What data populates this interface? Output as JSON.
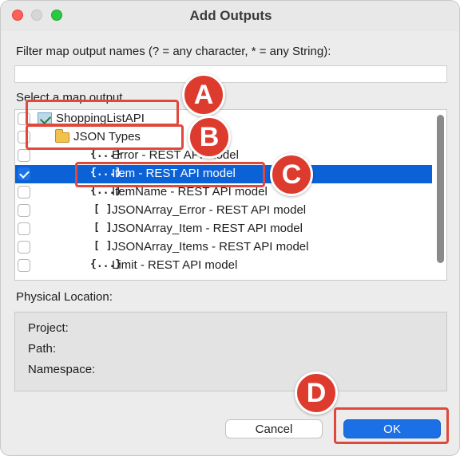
{
  "window": {
    "title": "Add Outputs"
  },
  "filter": {
    "label": "Filter map output names (? = any character, * = any String):",
    "value": ""
  },
  "select": {
    "label": "Select a map output"
  },
  "tree": {
    "rows": [
      {
        "label": "ShoppingListAPI",
        "icon": "api-project-icon",
        "checked": false,
        "selected": false
      },
      {
        "label": "JSON Types",
        "icon": "folder-icon",
        "checked": false,
        "selected": false
      },
      {
        "label": "Error - REST API model",
        "icon": "{...}",
        "checked": false,
        "selected": false
      },
      {
        "label": "Item - REST API model",
        "icon": "{...}",
        "checked": true,
        "selected": true
      },
      {
        "label": "ItemName - REST API model",
        "icon": "{...}",
        "checked": false,
        "selected": false
      },
      {
        "label": "JSONArray_Error - REST API model",
        "icon": "[ ]",
        "checked": false,
        "selected": false
      },
      {
        "label": "JSONArray_Item - REST API model",
        "icon": "[ ]",
        "checked": false,
        "selected": false
      },
      {
        "label": "JSONArray_Items - REST API model",
        "icon": "[ ]",
        "checked": false,
        "selected": false
      },
      {
        "label": "Limit - REST API model",
        "icon": "{...}",
        "checked": false,
        "selected": false
      }
    ]
  },
  "physical": {
    "label": "Physical Location:",
    "project_label": "Project:",
    "path_label": "Path:",
    "namespace_label": "Namespace:"
  },
  "buttons": {
    "cancel": "Cancel",
    "ok": "OK"
  },
  "callouts": {
    "a": "A",
    "b": "B",
    "c": "C",
    "d": "D"
  },
  "colors": {
    "accent": "#1c6fe4",
    "selection": "#0b61d6",
    "callout": "#de3b2f"
  }
}
